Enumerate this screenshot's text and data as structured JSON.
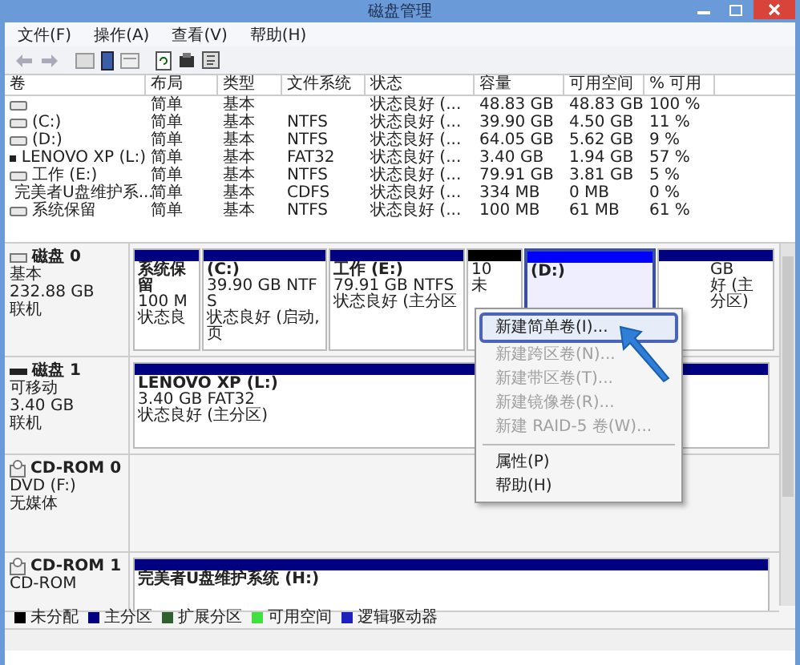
{
  "window": {
    "title": "磁盘管理"
  },
  "menu": [
    "文件(F)",
    "操作(A)",
    "查看(V)",
    "帮助(H)"
  ],
  "table": {
    "columns": [
      "卷",
      "布局",
      "类型",
      "文件系统",
      "状态",
      "容量",
      "可用空间",
      "% 可用"
    ],
    "rows": [
      {
        "kind": "drive",
        "cells": [
          "",
          "简单",
          "基本",
          "",
          "状态良好 (...",
          "48.83 GB",
          "48.83 GB",
          "100 %"
        ]
      },
      {
        "kind": "drive",
        "cells": [
          "(C:)",
          "简单",
          "基本",
          "NTFS",
          "状态良好 (...",
          "39.90 GB",
          "4.50 GB",
          "11 %"
        ]
      },
      {
        "kind": "drive",
        "cells": [
          "(D:)",
          "简单",
          "基本",
          "NTFS",
          "状态良好 (...",
          "64.05 GB",
          "5.62 GB",
          "9 %"
        ]
      },
      {
        "kind": "usb",
        "cells": [
          "LENOVO XP (L:)",
          "简单",
          "基本",
          "FAT32",
          "状态良好 (...",
          "3.40 GB",
          "1.94 GB",
          "57 %"
        ]
      },
      {
        "kind": "drive",
        "cells": [
          "工作 (E:)",
          "简单",
          "基本",
          "NTFS",
          "状态良好 (...",
          "79.91 GB",
          "3.81 GB",
          "5 %"
        ]
      },
      {
        "kind": "cd",
        "cells": [
          "完美者U盘维护系...",
          "简单",
          "基本",
          "CDFS",
          "状态良好 (...",
          "334 MB",
          "0 MB",
          "0 %"
        ]
      },
      {
        "kind": "drive",
        "cells": [
          "系统保留",
          "简单",
          "基本",
          "NTFS",
          "状态良好 (...",
          "100 MB",
          "61 MB",
          "61 %"
        ]
      }
    ]
  },
  "disks": [
    {
      "kind": "hdd",
      "name": "磁盘 0",
      "lines": [
        "基本",
        "232.88 GB",
        "联机"
      ],
      "partitions": [
        {
          "name": "系统保留",
          "lines": [
            "100 M",
            "状态良"
          ],
          "color": "#000080",
          "selected": false
        },
        {
          "name": "(C:)",
          "lines": [
            "39.90 GB NTFS",
            "状态良好 (启动, 页"
          ],
          "color": "#000080",
          "selected": false
        },
        {
          "name": "工作 (E:)",
          "lines": [
            "79.91 GB NTFS",
            "状态良好 (主分区"
          ],
          "color": "#000080",
          "selected": false
        },
        {
          "lines": [
            "10",
            "未"
          ],
          "color": "#000000",
          "selected": false
        },
        {
          "name": "(D:)",
          "color": "#0000ff",
          "selected": true
        },
        {
          "lines": [
            "GB",
            "好 (主分区)"
          ],
          "color": "#000080",
          "selected": false
        }
      ]
    },
    {
      "kind": "removable",
      "name": "磁盘 1",
      "lines": [
        "可移动",
        "3.40 GB",
        "联机"
      ],
      "partitions": [
        {
          "name": "LENOVO XP (L:)",
          "lines": [
            "3.40 GB FAT32",
            "状态良好 (主分区)"
          ],
          "color": "#000080",
          "selected": false
        }
      ]
    },
    {
      "kind": "cdrom",
      "name": "CD-ROM 0",
      "lines": [
        "DVD (F:)",
        "无媒体"
      ]
    },
    {
      "kind": "cdrom",
      "name": "CD-ROM 1",
      "lines": [
        "CD-ROM"
      ],
      "partitions": [
        {
          "name": "完美者U盘维护系统 (H:)",
          "color": "#000080",
          "selected": false
        }
      ]
    }
  ],
  "legend": [
    {
      "label": "未分配",
      "color": "#000000"
    },
    {
      "label": "主分区",
      "color": "#000080"
    },
    {
      "label": "扩展分区",
      "color": "#306030"
    },
    {
      "label": "可用空间",
      "color": "#40e040"
    },
    {
      "label": "逻辑驱动器",
      "color": "#2020c0"
    }
  ],
  "context_menu": [
    {
      "label": "新建简单卷(I)...",
      "disabled": false,
      "selected": true,
      "separator_before": false
    },
    {
      "label": "新建跨区卷(N)...",
      "disabled": true,
      "selected": false,
      "separator_before": false
    },
    {
      "label": "新建带区卷(T)...",
      "disabled": true,
      "selected": false,
      "separator_before": false
    },
    {
      "label": "新建镜像卷(R)...",
      "disabled": true,
      "selected": false,
      "separator_before": false
    },
    {
      "label": "新建 RAID-5 卷(W)...",
      "disabled": true,
      "selected": false,
      "separator_before": false
    },
    {
      "label": "属性(P)",
      "disabled": false,
      "selected": false,
      "separator_before": true
    },
    {
      "label": "帮助(H)",
      "disabled": false,
      "selected": false,
      "separator_before": false
    }
  ]
}
